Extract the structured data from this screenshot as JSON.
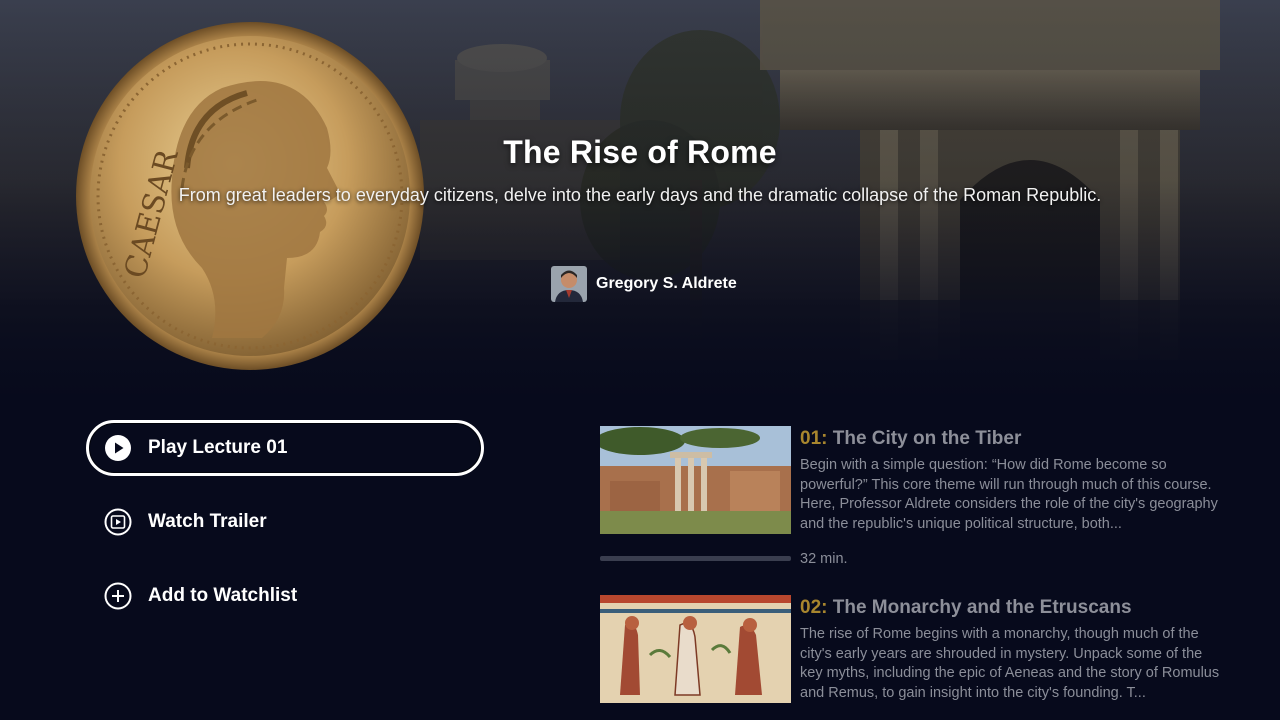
{
  "course": {
    "title": "The Rise of Rome",
    "subtitle": "From great leaders to everyday citizens, delve into the early days and the dramatic collapse of the Roman Republic.",
    "coin_inscription": "CAESAR"
  },
  "professor": {
    "name": "Gregory S. Aldrete"
  },
  "actions": [
    {
      "label": "Play Lecture 01",
      "icon": "play-circle-icon",
      "focused": true
    },
    {
      "label": "Watch Trailer",
      "icon": "film-reel-icon",
      "focused": false
    },
    {
      "label": "Add to Watchlist",
      "icon": "plus-circle-icon",
      "focused": false
    }
  ],
  "lectures": [
    {
      "number": "01:",
      "title": "The City on the Tiber",
      "description": "Begin with a simple question: “How did Rome become so powerful?” This core theme will run through much of this course. Here, Professor Aldrete considers the role of the city's geography and the republic's unique political structure, both...",
      "duration": "32 min.",
      "progress": 1.0
    },
    {
      "number": "02:",
      "title": "The Monarchy and the Etruscans",
      "description": "The rise of Rome begins with a monarchy, though much of the city's early years are shrouded in mystery. Unpack some of the key myths, including the epic of Aeneas and the story of Romulus and Remus, to gain insight into the city's founding. T...",
      "duration": "",
      "progress": null
    }
  ],
  "colors": {
    "background": "#070a1c",
    "lecture_number": "#a8862e",
    "muted_text": "#8b8e99",
    "progress_track": "#3a3e4f"
  }
}
